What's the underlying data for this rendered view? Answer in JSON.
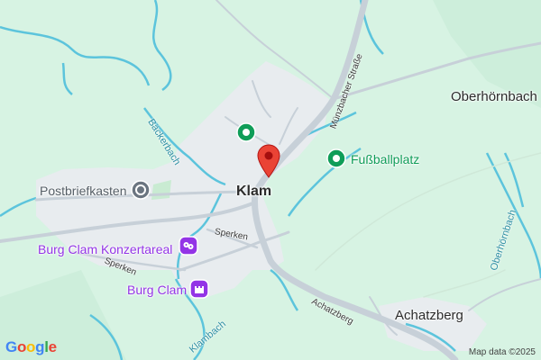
{
  "map": {
    "places": {
      "klam": "Klam",
      "oberhornbach": "Oberhörnbach",
      "achatzberg": "Achatzberg"
    },
    "pois": {
      "postbriefkasten": "Postbriefkasten",
      "fussballplatz": "Fußballplatz",
      "konzertareal": "Burg Clam Konzertareal",
      "burg_clam": "Burg Clam"
    },
    "streets": {
      "munzbacher_strasse": "Münzbacher Straße",
      "sperken_1": "Sperken",
      "sperken_2": "Sperken",
      "achatzberg_road": "Achatzberg"
    },
    "waterways": {
      "backerbach": "Bäckerbach",
      "klambach": "Klambach",
      "oberhornbach_creek": "Oberhörnbach"
    },
    "icons": {
      "selected_pin": "red-location-pin-icon",
      "green_marker": "green-place-marker-icon",
      "mailbox": "mailbox-marker-icon",
      "theater": "theater-marker-icon",
      "castle": "castle-marker-icon"
    },
    "colors": {
      "background": "#d7f3e3",
      "settlement": "#e8ecef",
      "water": "#5cc4dc",
      "road": "#c7d0d8",
      "pin_red": "#ea4335",
      "poi_green": "#0f9d58",
      "poi_purple": "#9334e6",
      "poi_gray": "#6b7580"
    },
    "attribution": "Map data ©2025",
    "logo": {
      "text": "Google",
      "letters": [
        "G",
        "o",
        "o",
        "g",
        "l",
        "e"
      ]
    }
  }
}
